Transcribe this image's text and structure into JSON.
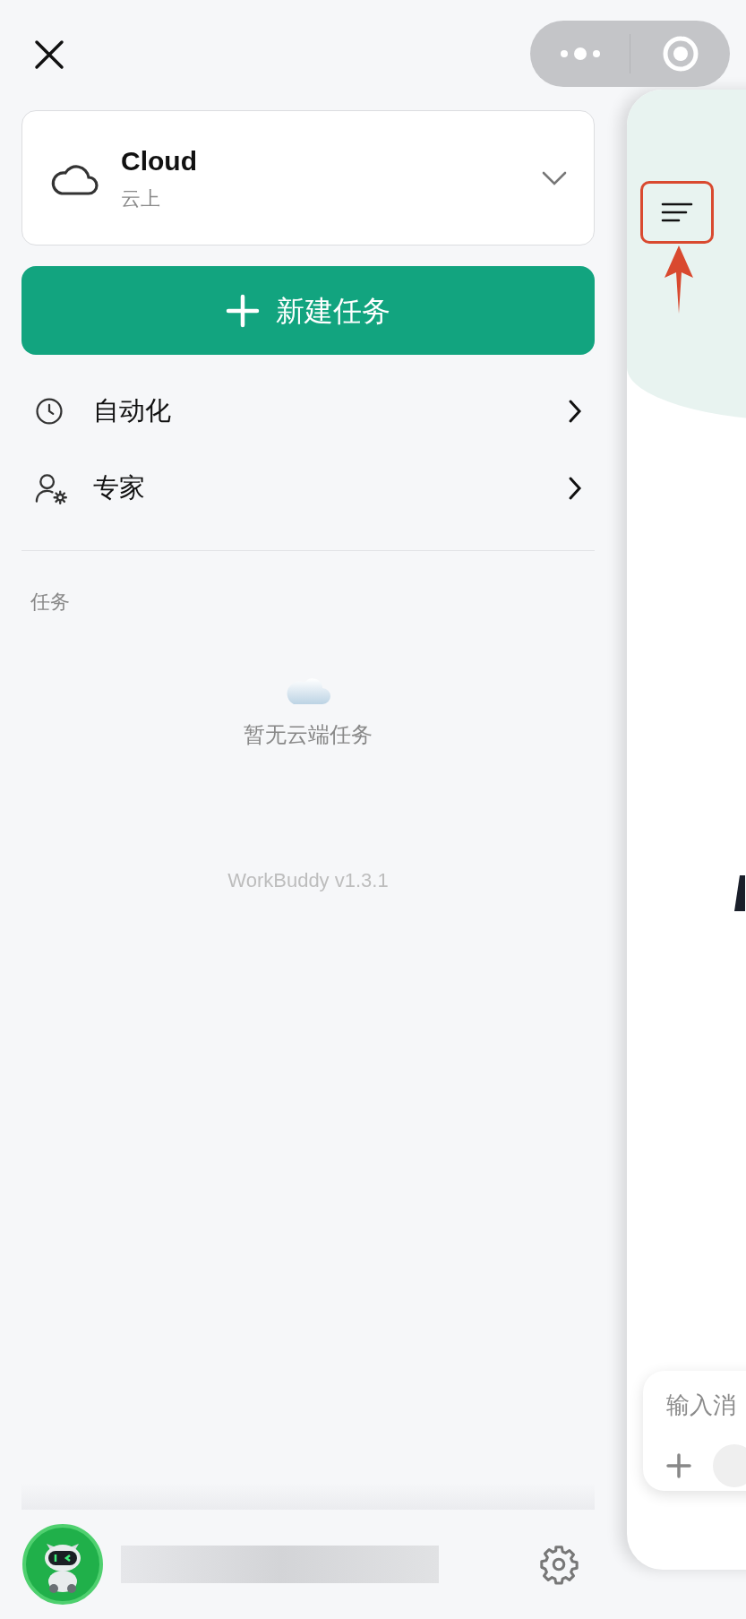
{
  "workspace": {
    "title": "Cloud",
    "subtitle": "云上"
  },
  "new_task_button": {
    "label": "新建任务"
  },
  "nav_items": [
    {
      "label": "自动化",
      "kind": "automation"
    },
    {
      "label": "专家",
      "kind": "experts"
    }
  ],
  "tasks_section": {
    "heading": "任务",
    "empty_text": "暂无云端任务"
  },
  "version": "WorkBuddy v1.3.1",
  "main_panel": {
    "input": {
      "placeholder": "输入消"
    }
  }
}
